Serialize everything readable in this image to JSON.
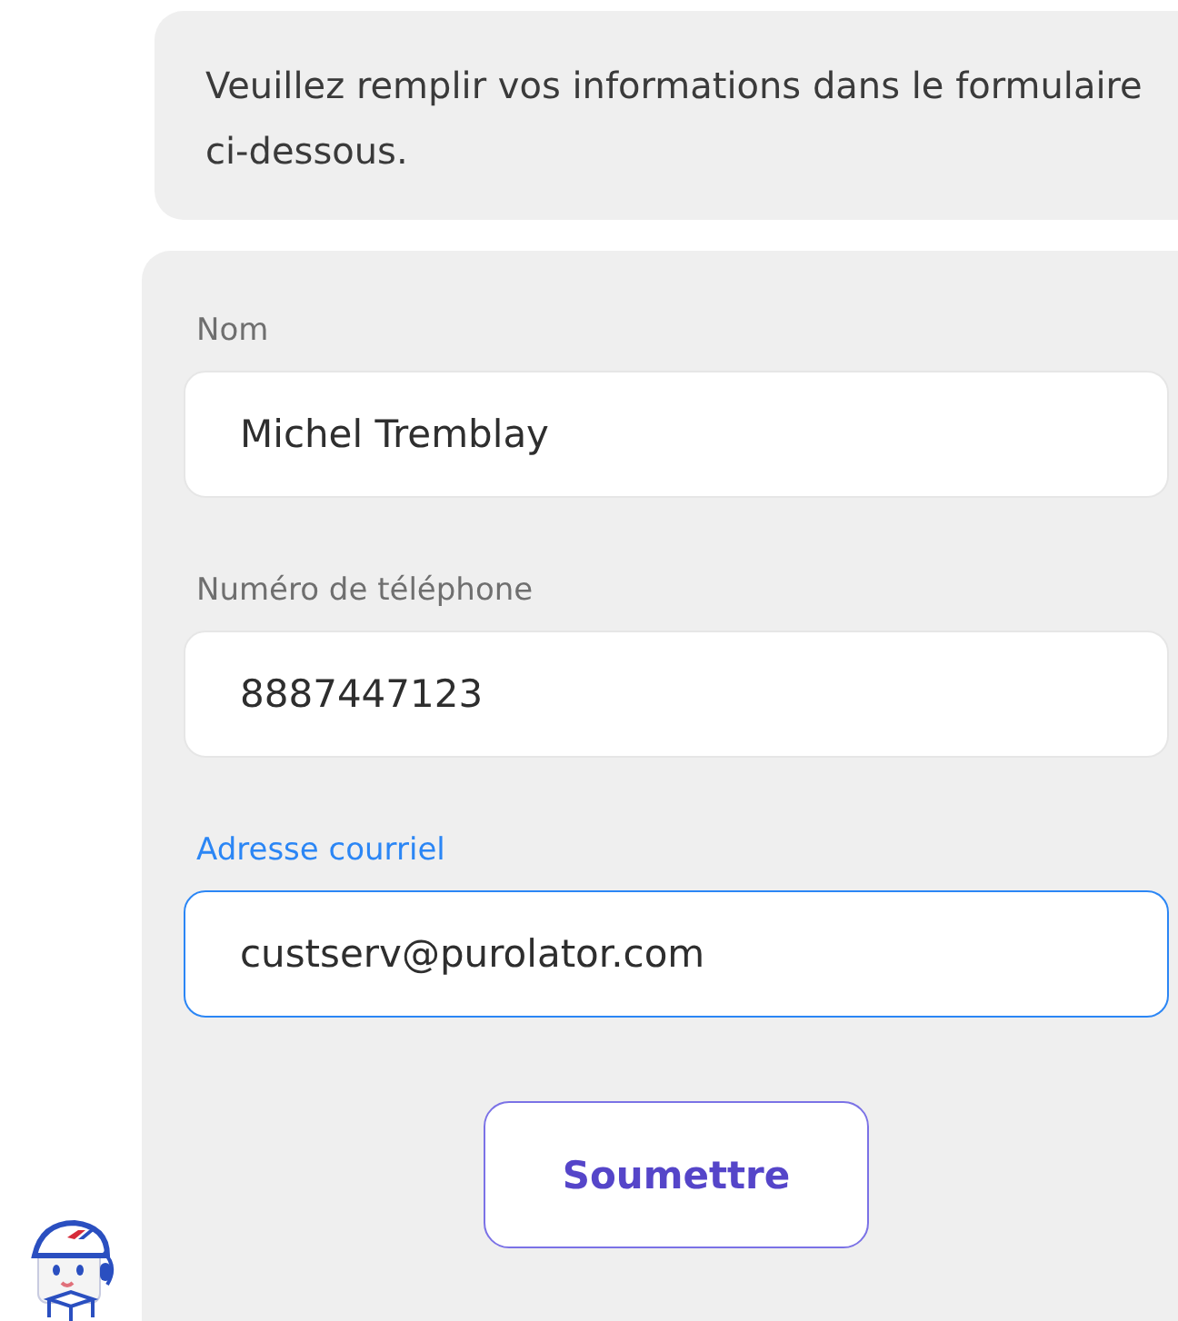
{
  "message": {
    "text": "Veuillez remplir vos informations dans le formulaire ci-dessous."
  },
  "form": {
    "fields": [
      {
        "label": "Nom",
        "value": "Michel Tremblay",
        "focused": false
      },
      {
        "label": "Numéro de téléphone",
        "value": "8887447123",
        "focused": false
      },
      {
        "label": "Adresse courriel",
        "value": "custserv@purolator.com",
        "focused": true
      }
    ],
    "submit": {
      "label": "Soumettre"
    }
  }
}
